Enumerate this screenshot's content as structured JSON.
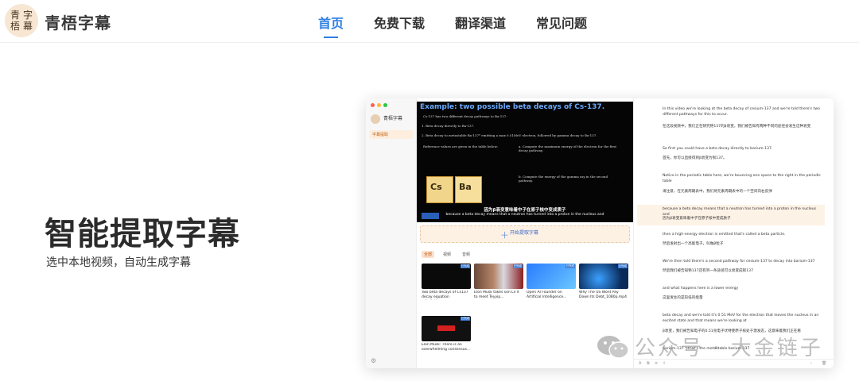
{
  "logo": {
    "seal_chars": [
      "青",
      "字",
      "梧",
      "幕"
    ]
  },
  "brand": "青梧字幕",
  "nav": [
    {
      "label": "首页",
      "active": true
    },
    {
      "label": "免费下载",
      "active": false
    },
    {
      "label": "翻译渠道",
      "active": false
    },
    {
      "label": "常见问题",
      "active": false
    }
  ],
  "accent_color": "#2e7fe0",
  "hero": {
    "title": "智能提取字幕",
    "subtitle": "选中本地视频，自动生成字幕"
  },
  "app": {
    "name": "青梧字幕",
    "nav_item": "字幕提取",
    "video": {
      "title": "Example:  two possible beta decays of Cs-137.",
      "line1": "Cs-137 has two different decay pathways to Ba-137:",
      "line2": "1.  Beta decay directly to Ba-137.",
      "line3": "2.  Beta decay to metastable Ba-137* emitting a max 0.51MeV electron, followed by gamma decay to Ba-137.",
      "line4": "Reference values are given in the table below:",
      "q_a": "a.  Compute the maximum energy of the electron for the first decay pathway.",
      "q_b": "b.  Compute the energy of the gamma ray in the second pathway.",
      "tile1_symbol": "Cs",
      "tile2_symbol": "Ba",
      "caption_zh": "因为β衰变意味着中子在原子核中变成质子",
      "caption_en": "because a beta decay means that a neutron has turned into a proton in the nucleus and"
    },
    "extract_button": "开始提取字幕",
    "filter_tabs": [
      {
        "label": "全部",
        "active": true
      },
      {
        "label": "视频",
        "active": false
      },
      {
        "label": "音频",
        "active": false
      }
    ],
    "cards": [
      {
        "title": "Two beta decays of Cs137 decay equation calculatio...",
        "tag": "已完成"
      },
      {
        "title": "Elon Musk takes son Lil X to meet Teyyip...",
        "tag": "已完成"
      },
      {
        "title": "Open AI Founder on Artificial Intelligence...",
        "tag": "已完成"
      },
      {
        "title": "Why The US Wont Pay Down Its Debt_1080p.mp4",
        "tag": "已完成"
      },
      {
        "title": "Elon Musk: There is an overwhelming consensus...",
        "tag": "已完成"
      }
    ],
    "subtitles": [
      {
        "en": "In this video we're looking at the beta decay of cesium-137 and we're told there's two different pathways for this to occur.",
        "zh": "在这段视频中，我们正在研究铯137的β衰变，我们被告知有两种不同的途径会发生这种衰变"
      },
      {
        "en": "So first you could have a beta decay directly to barium-137.",
        "zh": "首先，你可以直接得到β衰变为钡137。"
      },
      {
        "en": "Notice in the periodic table here, we're bouncing one space to the right in the periodic table",
        "zh": "请注意，在元素周期表中，我们将元素周期表中的一个空间向右反弹"
      },
      {
        "en": "because a beta decay means that a neutron has turned into a proton in the nucleus and",
        "zh": "因为β衰变意味着中子在原子核中变成质子"
      },
      {
        "en": "then a high-energy electron is emitted that's called a beta particle.",
        "zh": "然后发射出一个高能电子，叫做β粒子"
      },
      {
        "en": "We're then told there's a second pathway for cesium-137 to decay into barium-137",
        "zh": "然后我们被告知铯137还有另一条途径可以衰变成钡137"
      },
      {
        "en": "and what happens here is a lower energy",
        "zh": "这里发生的是较低的能量"
      },
      {
        "en": "beta decay and we're told it's 0.51 MeV for the electron that leaves the nucleus in an excited state and that means we're looking at",
        "zh": "β衰变，我们被告知电子的0.51兆电子伏特使原子核处于激发态，这意味着我们正在看"
      },
      {
        "en": "barium-137 * that's the metastable barium-137",
        "zh": ""
      }
    ]
  },
  "watermark": "公众号 · 大金链子"
}
